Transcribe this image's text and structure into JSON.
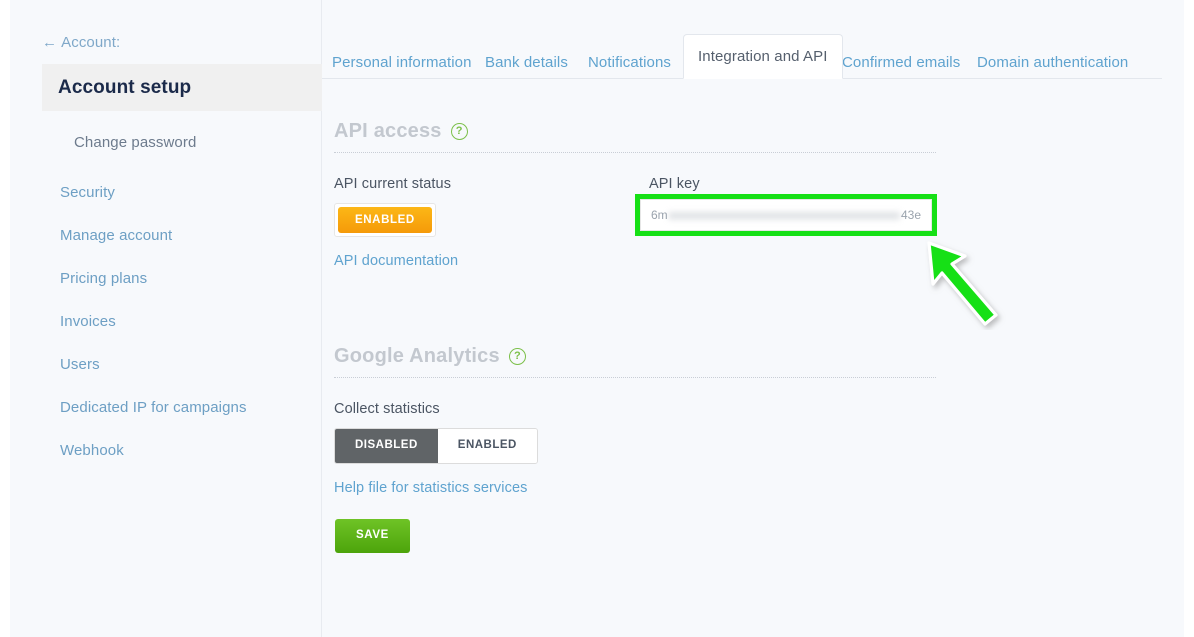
{
  "sidebar": {
    "back_link": "Account:",
    "back_arrow": "←",
    "active_item": "Account setup",
    "sub_item": "Change password",
    "items": [
      {
        "label": "Security"
      },
      {
        "label": "Manage account"
      },
      {
        "label": "Pricing plans"
      },
      {
        "label": "Invoices"
      },
      {
        "label": "Users"
      },
      {
        "label": "Dedicated IP for campaigns"
      },
      {
        "label": "Webhook"
      }
    ]
  },
  "tabs": [
    {
      "label": "Personal information",
      "active": false
    },
    {
      "label": "Bank details",
      "active": false
    },
    {
      "label": "Notifications",
      "active": false
    },
    {
      "label": "Integration and API",
      "active": true
    },
    {
      "label": "Confirmed emails",
      "active": false
    },
    {
      "label": "Domain authentication",
      "active": false
    }
  ],
  "api_access": {
    "title": "API access",
    "help_icon": "?",
    "status_label": "API current status",
    "status_button": "ENABLED",
    "documentation_link": "API documentation",
    "key_label": "API key",
    "key_prefix": "6m",
    "key_masked": "xxxxxxxxxxxxxxxxxxxxxxxxxxxxxxxxxxxxxxxxxxxx",
    "key_suffix": "43e"
  },
  "google_analytics": {
    "title": "Google Analytics",
    "help_icon": "?",
    "collect_label": "Collect statistics",
    "toggle_options": [
      {
        "label": "DISABLED",
        "active": true
      },
      {
        "label": "ENABLED",
        "active": false
      }
    ],
    "help_link": "Help file for statistics services",
    "save_button": "SAVE"
  },
  "annotation": {
    "highlight_color": "#16e016",
    "arrow_color": "#16e016"
  }
}
